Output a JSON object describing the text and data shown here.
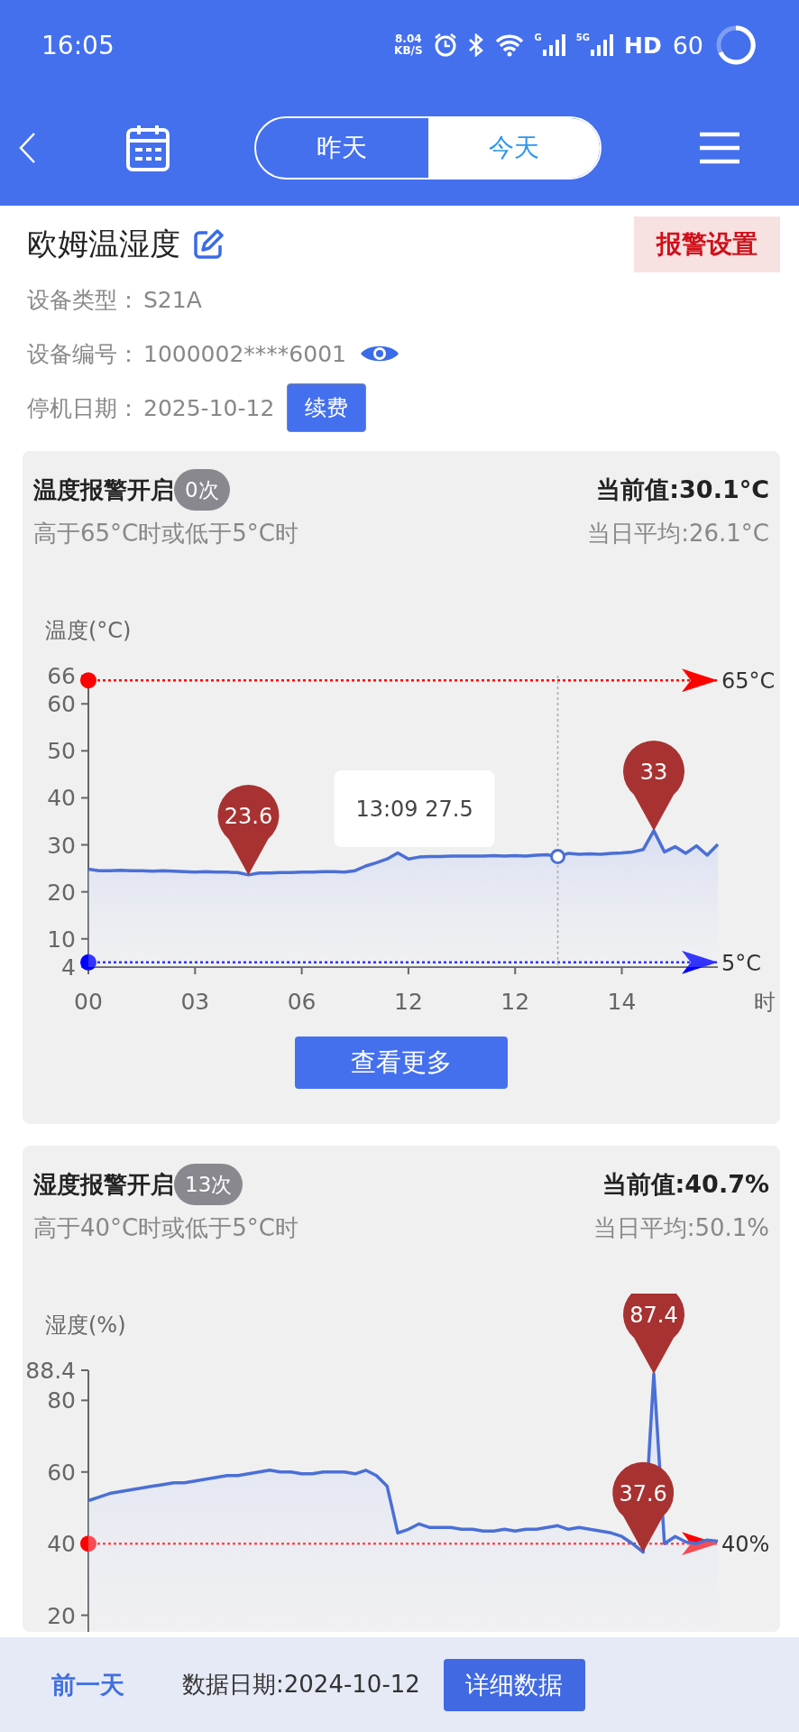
{
  "status_bar": {
    "time": "16:05",
    "speed": "8.04",
    "speed_unit": "KB/S",
    "signals": [
      {
        "label": "G"
      },
      {
        "label": "5G"
      }
    ],
    "hd": "HD",
    "battery": "60"
  },
  "nav": {
    "tabs": [
      {
        "label": "昨天",
        "selected": false
      },
      {
        "label": "今天",
        "selected": true
      }
    ]
  },
  "device": {
    "name": "欧姆温湿度",
    "alarm_button": "报警设置",
    "fields": [
      {
        "kind": "text",
        "label": "设备类型：",
        "value": "S21A"
      },
      {
        "kind": "masked",
        "label": "设备编号：",
        "value": "1000002****6001"
      },
      {
        "kind": "renew",
        "label": "停机日期：",
        "value": "2025-10-12",
        "button": "续费"
      }
    ]
  },
  "cards": [
    {
      "title": "温度报警开启",
      "count": "0次",
      "current": "当前值:30.1°C",
      "rule": "高于65°C时或低于5°C时",
      "average": "当日平均:26.1°C",
      "button": "查看更多",
      "tooltip": "13:09 27.5",
      "chart_data": {
        "type": "area",
        "ylabel": "温度(°C)",
        "xlabel": "时",
        "ylim": [
          4,
          66
        ],
        "yticks": [
          4,
          10,
          20,
          30,
          40,
          50,
          60,
          66
        ],
        "categories": [
          "00",
          null,
          null,
          null,
          null,
          null,
          null,
          null,
          null,
          null,
          "03",
          null,
          null,
          null,
          null,
          null,
          null,
          null,
          null,
          null,
          "06",
          null,
          null,
          null,
          null,
          null,
          null,
          null,
          null,
          null,
          "12",
          null,
          null,
          null,
          null,
          null,
          null,
          null,
          null,
          null,
          "12",
          null,
          null,
          null,
          null,
          null,
          null,
          null,
          null,
          null,
          "14",
          null,
          null,
          null,
          null,
          null,
          null,
          null,
          null,
          null
        ],
        "series": [
          {
            "color": "#4a6fd6",
            "values": [
              24.8,
              24.5,
              24.5,
              24.6,
              24.5,
              24.5,
              24.4,
              24.5,
              24.4,
              24.3,
              24.2,
              24.3,
              24.2,
              24.2,
              24.1,
              23.6,
              24.0,
              24.0,
              24.1,
              24.1,
              24.2,
              24.2,
              24.3,
              24.3,
              24.2,
              24.5,
              25.5,
              26.2,
              27.0,
              28.3,
              27.0,
              27.4,
              27.5,
              27.5,
              27.6,
              27.6,
              27.6,
              27.6,
              27.7,
              27.6,
              27.7,
              27.6,
              27.8,
              27.9,
              27.5,
              28.2,
              28.0,
              28.1,
              28.0,
              28.2,
              28.3,
              28.5,
              29.0,
              33.0,
              28.5,
              29.6,
              28.2,
              29.8,
              27.8,
              30.1
            ]
          }
        ],
        "ref_lines": [
          {
            "axis": "y",
            "value": 65,
            "label": "65°C",
            "color": "#ff0000"
          },
          {
            "axis": "y",
            "value": 5,
            "label": "5°C",
            "color": "#0000ff"
          }
        ],
        "annotations": [
          {
            "y": 23.6,
            "text": "23.6"
          },
          {
            "y": 33,
            "text": "33"
          }
        ]
      }
    },
    {
      "title": "湿度报警开启",
      "count": "13次",
      "current": "当前值:40.7%",
      "rule": "高于40°C时或低于5°C时",
      "average": "当日平均:50.1%",
      "chart_data": {
        "type": "area",
        "ylabel": "湿度(%)",
        "ylim": [
          0,
          88.4
        ],
        "categories": [
          null,
          null,
          null,
          null,
          null,
          null,
          null,
          null,
          null,
          null,
          null,
          null,
          null,
          null,
          null,
          null,
          null,
          null,
          null,
          null,
          null,
          null,
          null,
          null,
          null,
          null,
          null,
          null,
          null,
          null,
          null,
          null,
          null,
          null,
          null,
          null,
          null,
          null,
          null,
          null,
          null,
          null,
          null,
          null,
          null,
          null,
          null,
          null,
          null,
          null,
          null,
          null,
          null,
          null,
          null,
          null,
          null,
          null,
          null,
          null
        ],
        "yticks": [
          20,
          40,
          60,
          80,
          88.4
        ],
        "series": [
          {
            "color": "#4a6fd6",
            "values": [
              52,
              53,
              54,
              54.5,
              55,
              55.5,
              56,
              56.5,
              57,
              57,
              57.5,
              58,
              58.5,
              59,
              59,
              59.5,
              60,
              60.5,
              60,
              60,
              59.5,
              59.5,
              60,
              60,
              60,
              59.5,
              60.5,
              59,
              56,
              43,
              44,
              45.5,
              44.5,
              44.5,
              44.5,
              44,
              44,
              43.5,
              43.5,
              44,
              43.5,
              44,
              44,
              44.5,
              45,
              44,
              44.5,
              44,
              43.5,
              43,
              42,
              40,
              37.6,
              87.4,
              40,
              42,
              40.5,
              40,
              41,
              40.7
            ]
          }
        ],
        "ref_lines": [
          {
            "axis": "y",
            "value": 40,
            "label": "40%",
            "color": "#ff0000"
          }
        ],
        "annotations": [
          {
            "y": 87.4,
            "text": "87.4"
          },
          {
            "y": 37.6,
            "text": "37.6"
          }
        ]
      }
    }
  ],
  "bottom_bar": {
    "prev_button": "前一天",
    "date": "数据日期:2024-10-12",
    "detail_button": "详细数据"
  }
}
